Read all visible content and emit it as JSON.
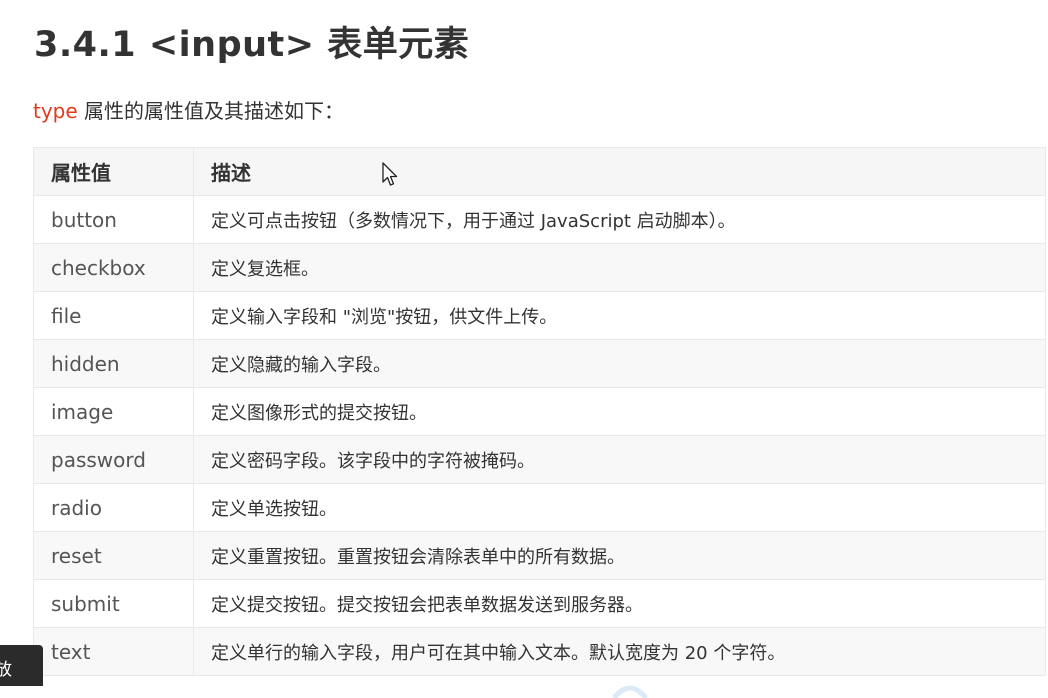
{
  "heading": {
    "text": "3.4.1 <input> 表单元素"
  },
  "intro": {
    "keyword": "type",
    "text": " 属性的属性值及其描述如下："
  },
  "table": {
    "headers": [
      "属性值",
      "描述"
    ],
    "rows": [
      {
        "value": "button",
        "desc": "定义可点击按钮（多数情况下，用于通过 JavaScript 启动脚本）。"
      },
      {
        "value": "checkbox",
        "desc": "定义复选框。"
      },
      {
        "value": "file",
        "desc": "定义输入字段和 \"浏览\"按钮，供文件上传。"
      },
      {
        "value": "hidden",
        "desc": "定义隐藏的输入字段。"
      },
      {
        "value": "image",
        "desc": "定义图像形式的提交按钮。"
      },
      {
        "value": "password",
        "desc": "定义密码字段。该字段中的字符被掩码。"
      },
      {
        "value": "radio",
        "desc": "定义单选按钮。"
      },
      {
        "value": "reset",
        "desc": "定义重置按钮。重置按钮会清除表单中的所有数据。"
      },
      {
        "value": "submit",
        "desc": "定义提交按钮。提交按钮会把表单数据发送到服务器。"
      },
      {
        "value": "text",
        "desc": "定义单行的输入字段，用户可在其中输入文本。默认宽度为 20 个字符。"
      }
    ]
  },
  "bottom_tab": {
    "label": "放"
  },
  "colors": {
    "keyword": "#e4391b",
    "text": "#333333",
    "header_bg": "#f6f6f6",
    "alt_row_bg": "#f8f8f8",
    "border": "#e8e8e8"
  }
}
